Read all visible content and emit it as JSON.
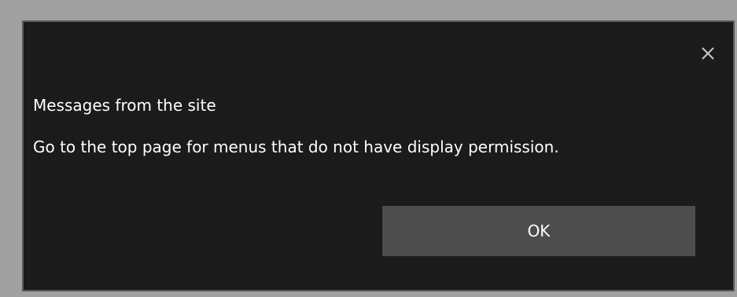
{
  "dialog": {
    "title": "Messages from the site",
    "message": "Go to the top page for menus that do not have display permission.",
    "ok_label": "OK",
    "close_icon": "close-icon"
  },
  "colors": {
    "backdrop": "#a0a0a0",
    "dialog_bg": "#1b1b1b",
    "dialog_border": "#5c5c5c",
    "button_bg": "#4d4d4d",
    "text": "#ffffff"
  }
}
